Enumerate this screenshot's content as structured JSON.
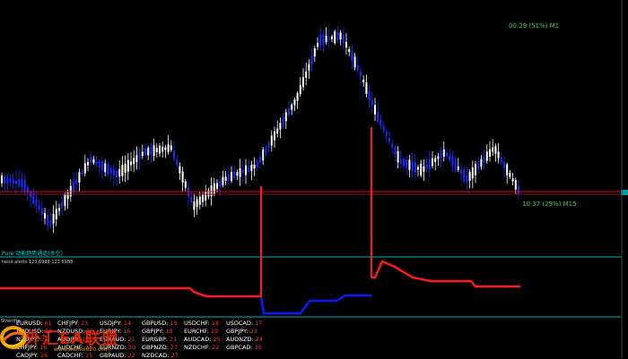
{
  "timers": {
    "m1": "00:29 (51%) M1",
    "m15": "10:37 (29%) M15"
  },
  "indicator": {
    "label_top": "Pure 动能趋势通道(多空)",
    "label_sub": "hend alerts 123 6988 123 6988"
  },
  "strength_panel": {
    "title": "Strenthe",
    "pairs": [
      {
        "name": "EURUSD:",
        "value": "61"
      },
      {
        "name": "CHFJPY:",
        "value": "23"
      },
      {
        "name": "USDJPY:",
        "value": "14"
      },
      {
        "name": "GBPUSD:",
        "value": "19"
      },
      {
        "name": "USDCHF:",
        "value": "18"
      },
      {
        "name": "USDCAD:",
        "value": "17"
      },
      {
        "name": "AUDUSD:",
        "value": "52"
      },
      {
        "name": "NZDUSD:",
        "value": "20"
      },
      {
        "name": "EURJPY:",
        "value": "15"
      },
      {
        "name": "GBPJPY:",
        "value": "19"
      },
      {
        "name": "EURCHF:",
        "value": "19"
      },
      {
        "name": "GBPJPY:",
        "value": "23"
      },
      {
        "name": "NZDJPY:",
        "value": "21"
      },
      {
        "name": "AUDJPY:",
        "value": "16"
      },
      {
        "name": "EURAUD:",
        "value": "21"
      },
      {
        "name": "EURGBP:",
        "value": "21"
      },
      {
        "name": "AUDCAD:",
        "value": "25"
      },
      {
        "name": "AUDNZD:",
        "value": "24"
      },
      {
        "name": "CHFJPY:",
        "value": "16"
      },
      {
        "name": "AUDCHF:",
        "value": "15"
      },
      {
        "name": "EURNZD:",
        "value": "30"
      },
      {
        "name": "GBPNZD:",
        "value": "27"
      },
      {
        "name": "NZDCHF:",
        "value": "22"
      },
      {
        "name": "GBPCAD:",
        "value": "35"
      },
      {
        "name": "CADJPY:",
        "value": "26"
      },
      {
        "name": "CADCHF:",
        "value": "15"
      },
      {
        "name": "GBPAUD:",
        "value": "22"
      },
      {
        "name": "NZDCAD:",
        "value": "27"
      }
    ]
  },
  "watermark": {
    "text": "外汇EA联盟",
    "url": "www.waihui020.com"
  },
  "colors": {
    "background": "#000000",
    "bull_candle": "#ffffff",
    "bear_candle": "#1a2cff",
    "price_line": "#c8102e",
    "separator": "#00b4b4",
    "indicator_bear": "#ff1a1a",
    "indicator_bull": "#0a1aff",
    "strength_value": "#ff3030"
  },
  "icons": {
    "logo": "orange-swirl-logo-icon"
  }
}
